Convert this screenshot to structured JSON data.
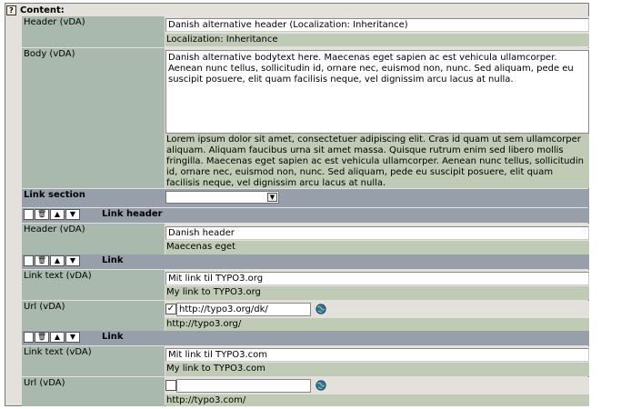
{
  "content_title": "Content:",
  "header": {
    "label": "Header (vDA)",
    "value": "Danish alternative header (Localization: Inheritance)",
    "original": "Localization: Inheritance"
  },
  "body": {
    "label": "Body (vDA)",
    "value": "Danish alternative bodytext here. Maecenas eget sapien ac est vehicula ullamcorper. Aenean nunc tellus, sollicitudin id, ornare nec, euismod non, nunc. Sed aliquam, pede eu suscipit posuere, elit quam facilisis neque, vel dignissim arcu lacus at nulla.",
    "original": "Lorem ipsum dolor sit amet, consectetuer adipiscing elit. Cras id quam ut sem ullamcorper aliquam. Aliquam faucibus urna sit amet massa. Quisque rutrum enim sed libero mollis fringilla. Maecenas eget sapien ac est vehicula ullamcorper. Aenean nunc tellus, sollicitudin id, ornare nec, euismod non, nunc. Sed aliquam, pede eu suscipit posuere, elit quam facilisis neque, vel dignissim arcu lacus at nulla."
  },
  "link_section": {
    "label": "Link section",
    "selected": ""
  },
  "link_header_section": {
    "title": "Link header",
    "header_label": "Header (vDA)",
    "header_value": "Danish header",
    "header_original": "Maecenas eget"
  },
  "links": [
    {
      "title": "Link",
      "text_label": "Link text (vDA)",
      "text_value": "Mit link til TYPO3.org",
      "text_original": "My link to TYPO3.org",
      "url_label": "Url (vDA)",
      "url_checked": true,
      "check_mark": "✓",
      "url_value": "http://typo3.org/dk/",
      "url_original": "http://typo3.org/"
    },
    {
      "title": "Link",
      "text_label": "Link text (vDA)",
      "text_value": "Mit link til TYPO3.com",
      "text_original": "My link to TYPO3.com",
      "url_label": "Url (vDA)",
      "url_checked": false,
      "check_mark": "",
      "url_value": "",
      "url_original": "http://typo3.com/"
    }
  ],
  "icons": {
    "help": "?",
    "trash": "🗑",
    "up": "▲",
    "down": "▼",
    "select_arrow": "▼"
  },
  "colors": {
    "label_bg": "#a9b9ae",
    "section_bg": "#979faa",
    "original_bg": "#bfcbb4",
    "frame_bg": "#e4e0db"
  }
}
